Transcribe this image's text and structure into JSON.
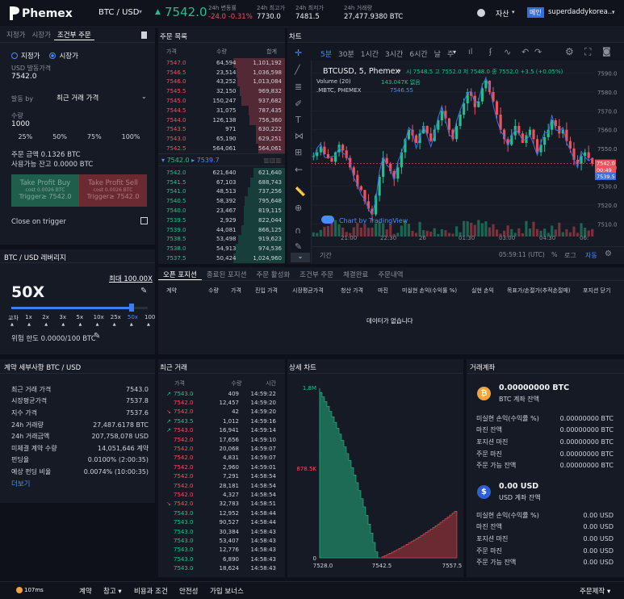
{
  "header": {
    "brand": "Phemex",
    "pair": "BTC / USD",
    "price": "7542.0",
    "stats": [
      {
        "label": "24h 변동률",
        "value": "-24.0 -0.31%",
        "cls": "red"
      },
      {
        "label": "24h 최고가",
        "value": "7730.0",
        "cls": "white"
      },
      {
        "label": "24h 최저가",
        "value": "7481.5",
        "cls": "white"
      },
      {
        "label": "24h 거래량",
        "value": "27,477.9380 BTC",
        "cls": "white"
      }
    ],
    "assets": "자산",
    "badge": "메인",
    "user": "superdaddykorea..."
  },
  "order": {
    "tabs": [
      "지정가",
      "시장가",
      "조건부 주문"
    ],
    "radio1": "지정가",
    "radio2": "시장가",
    "price_label": "USD 발동가격",
    "price_value": "7542.0",
    "trigger_label": "발동 by",
    "trigger_value": "최근 거래 가격",
    "qty_label": "수량",
    "qty_value": "1000",
    "pcts": [
      "25%",
      "50%",
      "75%",
      "100%"
    ],
    "cost": "주문 금액 0.1326 BTC",
    "avail": "사용가능 잔고 0.0000 BTC",
    "tp_buy": "Take Profit Buy",
    "tp_buy_sub": "cost 0.0026 BTC",
    "tp_buy_trig": "Trigger≥ 7542.0",
    "tp_sell": "Take Profit Sell",
    "tp_sell_sub": "cost 0.0026 BTC",
    "tp_sell_trig": "Trigger≥ 7542.0",
    "close_trigger": "Close on trigger"
  },
  "leverage": {
    "title": "BTC / USD 레버리지",
    "max": "최대 100.00X",
    "value": "50X",
    "ticks": [
      "교차",
      "1x",
      "2x",
      "3x",
      "5x",
      "10x",
      "25x",
      "50x",
      "100x"
    ],
    "level": 0.88,
    "risk": "위험 한도 0.0000/100 BTC"
  },
  "contract": {
    "title": "계약 세부사항 BTC / USD",
    "rows": [
      {
        "k": "최근 거래 가격",
        "v": "7543.0"
      },
      {
        "k": "시장평균가격",
        "v": "7537.8"
      },
      {
        "k": "지수 가격",
        "v": "7537.6"
      },
      {
        "k": "24h 거래량",
        "v": "27,487.6178 BTC"
      },
      {
        "k": "24h 거래금액",
        "v": "207,758,078 USD"
      },
      {
        "k": "미체결 계약 수량",
        "v": "14,051,646 계약"
      },
      {
        "k": "펀딩율",
        "v": "0.0100% (2:00:35)"
      },
      {
        "k": "예상 펀딩 비율",
        "v": "0.0074% (10:00:35)"
      }
    ],
    "more": "더보기"
  },
  "orderbook": {
    "title": "주문 목록",
    "headers": [
      "가격",
      "수량",
      "합계"
    ],
    "asks": [
      [
        "7547.0",
        "64,594",
        "1,101,192",
        1.0
      ],
      [
        "7546.5",
        "23,514",
        "1,036,598",
        0.94
      ],
      [
        "7546.0",
        "43,252",
        "1,013,084",
        0.92
      ],
      [
        "7545.5",
        "32,150",
        "969,832",
        0.88
      ],
      [
        "7545.0",
        "150,247",
        "937,682",
        0.85
      ],
      [
        "7544.5",
        "31,075",
        "787,435",
        0.71
      ],
      [
        "7544.0",
        "126,138",
        "756,360",
        0.69
      ],
      [
        "7543.5",
        "971",
        "630,222",
        0.57
      ],
      [
        "7543.0",
        "65,190",
        "629,251",
        0.57
      ],
      [
        "7542.5",
        "564,061",
        "564,061",
        0.51
      ]
    ],
    "mid": "7542.0",
    "mid2": "7539.7",
    "bids": [
      [
        "7542.0",
        "621,640",
        "621,640",
        0.61
      ],
      [
        "7541.5",
        "67,103",
        "688,743",
        0.67
      ],
      [
        "7541.0",
        "48,513",
        "737,256",
        0.72
      ],
      [
        "7540.5",
        "58,392",
        "795,648",
        0.78
      ],
      [
        "7540.0",
        "23,467",
        "819,115",
        0.8
      ],
      [
        "7539.5",
        "2,929",
        "822,044",
        0.8
      ],
      [
        "7539.0",
        "44,081",
        "866,125",
        0.85
      ],
      [
        "7538.5",
        "53,498",
        "919,623",
        0.9
      ],
      [
        "7538.0",
        "54,913",
        "974,536",
        0.95
      ],
      [
        "7537.5",
        "50,424",
        "1,024,960",
        1.0
      ]
    ]
  },
  "chart": {
    "title": "차트",
    "intervals": [
      "5분",
      "30분",
      "1시간",
      "3시간",
      "6시간",
      "날",
      "주"
    ],
    "symbol": "BTCUSD, 5, Phemex",
    "ohlc": "시 7548.5 고 7552.0 저 7548.0 종 7552.0 +3.5 (+0.05%)",
    "volume": "Volume (20)",
    "vol_val": "143.047K 없음",
    "mbtc": ".MBTC, PHEMEX",
    "mbtc_val": "7546.55",
    "watermark": "Chart by TradingView",
    "yticks": [
      "7590.0",
      "7580.0",
      "7570.0",
      "7560.0",
      "7550.0",
      "7540.0",
      "7530.0",
      "7520.0",
      "7510.0"
    ],
    "xticks": [
      "21:00",
      "22:30",
      "26",
      "01:30",
      "03:00",
      "04:30",
      "06:"
    ],
    "tag1": "7542.0",
    "tag2": "00:49",
    "tag3": "7539.5",
    "footer_left": "기간",
    "time": "05:59:11 (UTC)",
    "pct": "%",
    "log": "로그",
    "auto": "자동"
  },
  "positions": {
    "tabs": [
      "오픈 포지션",
      "종료된 포지션",
      "주문 활성화",
      "조건부 주문",
      "체결완료",
      "주문내역"
    ],
    "headers": [
      "계약",
      "수량",
      "가격",
      "진입 가격",
      "시장평균가격",
      "청산 가격",
      "마진",
      "미실현 손익(수익률 %)",
      "실현 손익",
      "목표가/손절가(추적손절매)",
      "포지션 닫기"
    ],
    "empty": "데이터가 없습니다"
  },
  "trades": {
    "title": "최근 거래",
    "headers": [
      "가격",
      "수량",
      "시간"
    ],
    "rows": [
      [
        "7543.0",
        "409",
        "14:59:22",
        "g",
        "up"
      ],
      [
        "7542.0",
        "12,457",
        "14:59:20",
        "r",
        ""
      ],
      [
        "7542.0",
        "42",
        "14:59:20",
        "r",
        "down"
      ],
      [
        "7543.5",
        "1,012",
        "14:59:16",
        "g",
        "up"
      ],
      [
        "7543.0",
        "16,941",
        "14:59:14",
        "r",
        "up"
      ],
      [
        "7542.0",
        "17,656",
        "14:59:10",
        "r",
        ""
      ],
      [
        "7542.0",
        "20,068",
        "14:59:07",
        "r",
        ""
      ],
      [
        "7542.0",
        "4,831",
        "14:59:07",
        "r",
        ""
      ],
      [
        "7542.0",
        "2,960",
        "14:59:01",
        "r",
        ""
      ],
      [
        "7542.0",
        "7,291",
        "14:58:54",
        "r",
        ""
      ],
      [
        "7542.0",
        "28,181",
        "14:58:54",
        "r",
        ""
      ],
      [
        "7542.0",
        "4,327",
        "14:58:54",
        "r",
        ""
      ],
      [
        "7542.0",
        "32,783",
        "14:58:51",
        "r",
        "down"
      ],
      [
        "7543.0",
        "12,952",
        "14:58:44",
        "g",
        ""
      ],
      [
        "7543.0",
        "90,527",
        "14:58:44",
        "g",
        ""
      ],
      [
        "7543.0",
        "30,384",
        "14:58:43",
        "g",
        ""
      ],
      [
        "7543.0",
        "53,407",
        "14:58:43",
        "g",
        ""
      ],
      [
        "7543.0",
        "12,776",
        "14:58:43",
        "g",
        ""
      ],
      [
        "7543.0",
        "6,890",
        "14:58:43",
        "g",
        ""
      ],
      [
        "7543.0",
        "18,624",
        "14:58:43",
        "g",
        ""
      ]
    ]
  },
  "depth": {
    "title": "상세 차트",
    "ylabels": [
      "1.8M",
      "878.5K",
      "0"
    ],
    "xlabels": [
      "7528.0",
      "7542.5",
      "7557.5"
    ]
  },
  "account": {
    "title": "거래계좌",
    "btc_amount": "0.00000000 BTC",
    "btc_sub": "BTC 계좌 잔액",
    "btc_rows": [
      {
        "k": "미실현 손익(수익률 %)",
        "v": "0.00000000 BTC"
      },
      {
        "k": "마진 잔액",
        "v": "0.00000000 BTC"
      },
      {
        "k": "포지션 마진",
        "v": "0.00000000 BTC"
      },
      {
        "k": "주문 마진",
        "v": "0.00000000 BTC"
      },
      {
        "k": "주문 가능 잔액",
        "v": "0.00000000 BTC"
      }
    ],
    "usd_amount": "0.00 USD",
    "usd_sub": "USD 계좌 잔액",
    "usd_rows": [
      {
        "k": "미실현 손익(수익률 %)",
        "v": "0.00 USD"
      },
      {
        "k": "마진 잔액",
        "v": "0.00 USD"
      },
      {
        "k": "포지션 마진",
        "v": "0.00 USD"
      },
      {
        "k": "주문 마진",
        "v": "0.00 USD"
      },
      {
        "k": "주문 가능 잔액",
        "v": "0.00 USD"
      }
    ]
  },
  "footer": {
    "latency": "107ms",
    "links": [
      "계약",
      "참고 ▾",
      "비용과 조건",
      "안전성",
      "가입 보너스"
    ],
    "lang": "주문제작 ▾"
  }
}
